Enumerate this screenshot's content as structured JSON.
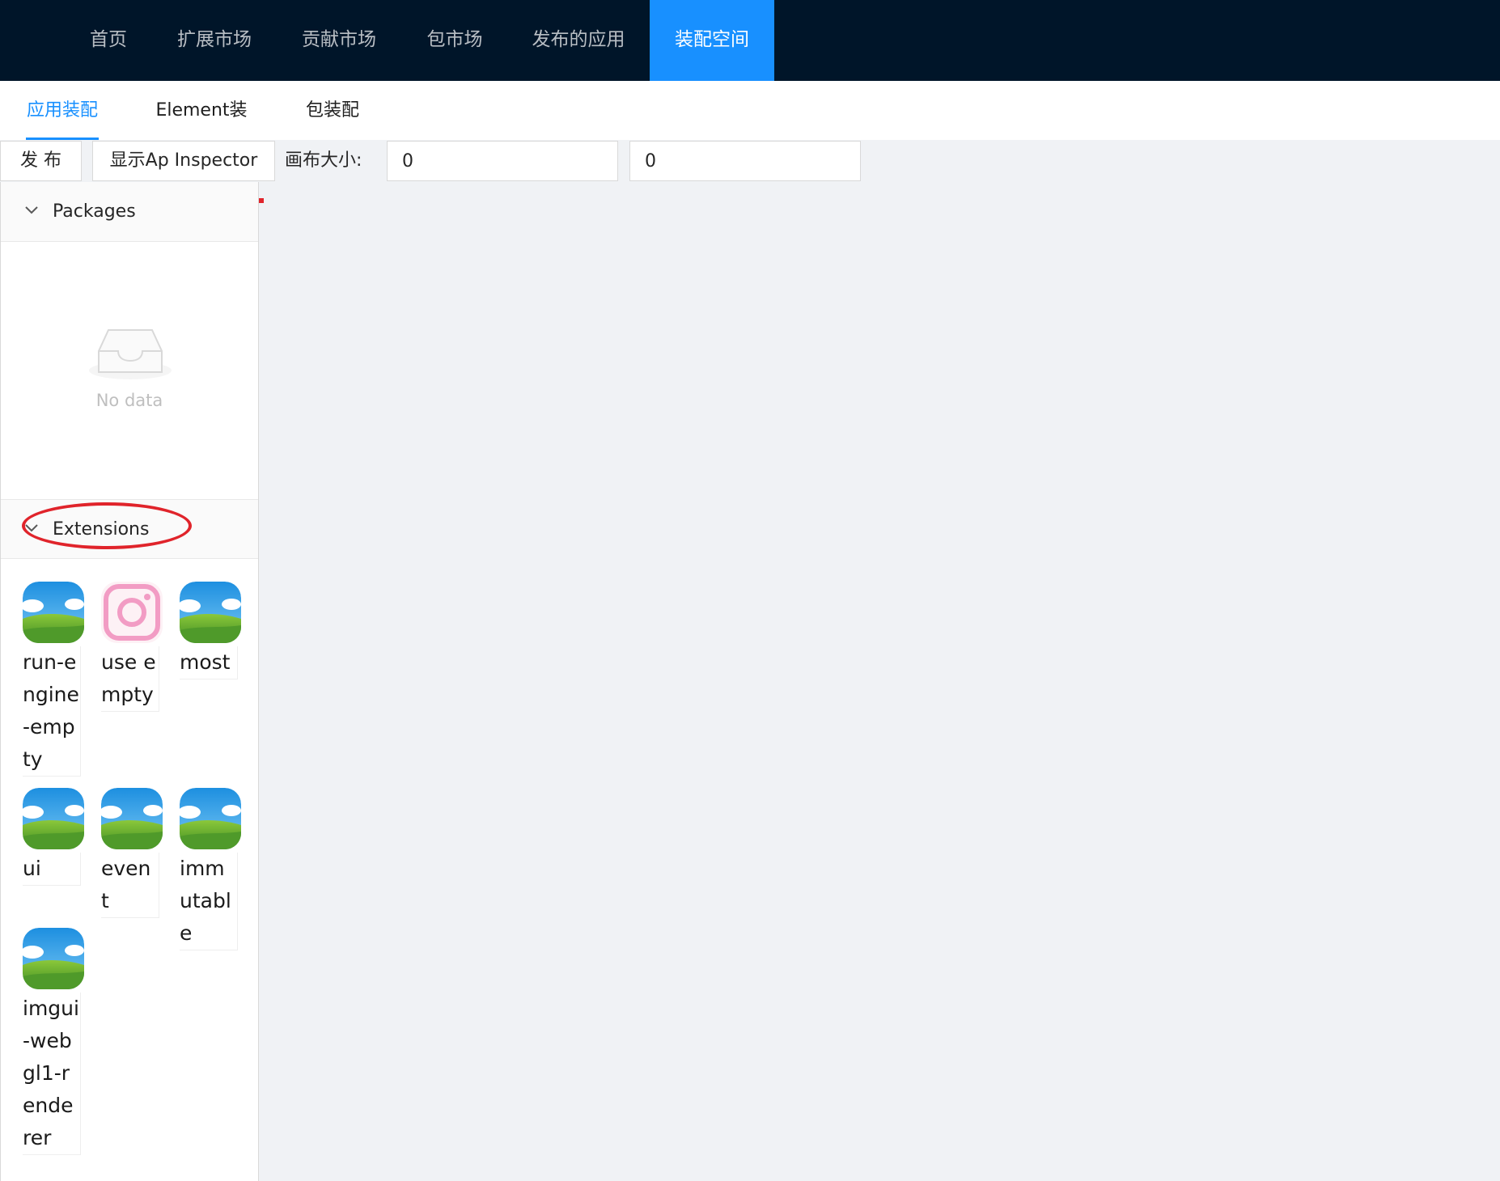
{
  "top_nav": {
    "items": [
      "首页",
      "扩展市场",
      "贡献市场",
      "包市场",
      "发布的应用",
      "装配空间"
    ],
    "active_index": 5,
    "bg_color": "#001529",
    "active_color": "#1890ff"
  },
  "sub_tabs": {
    "items": [
      "应用装配",
      "Element装配",
      "包装配"
    ],
    "active_index": 0
  },
  "toolbar": {
    "publish_label": "发 布",
    "inspector_label": "显示Ap Inspector",
    "canvas_size_label": "画布大小:",
    "width_value": "0",
    "height_value": "0"
  },
  "packages": {
    "title": "Packages",
    "empty_text": "No data"
  },
  "extensions": {
    "title": "Extensions",
    "items": [
      {
        "label": "run-engine-empty",
        "icon": "landscape-icon"
      },
      {
        "label": "use empty",
        "icon": "instagram-icon"
      },
      {
        "label": "most",
        "icon": "landscape-icon"
      },
      {
        "label": "ui",
        "icon": "landscape-icon"
      },
      {
        "label": "event",
        "icon": "landscape-icon"
      },
      {
        "label": "immutable",
        "icon": "landscape-icon"
      },
      {
        "label": "imgui-webgl1-renderer",
        "icon": "landscape-icon"
      }
    ]
  }
}
